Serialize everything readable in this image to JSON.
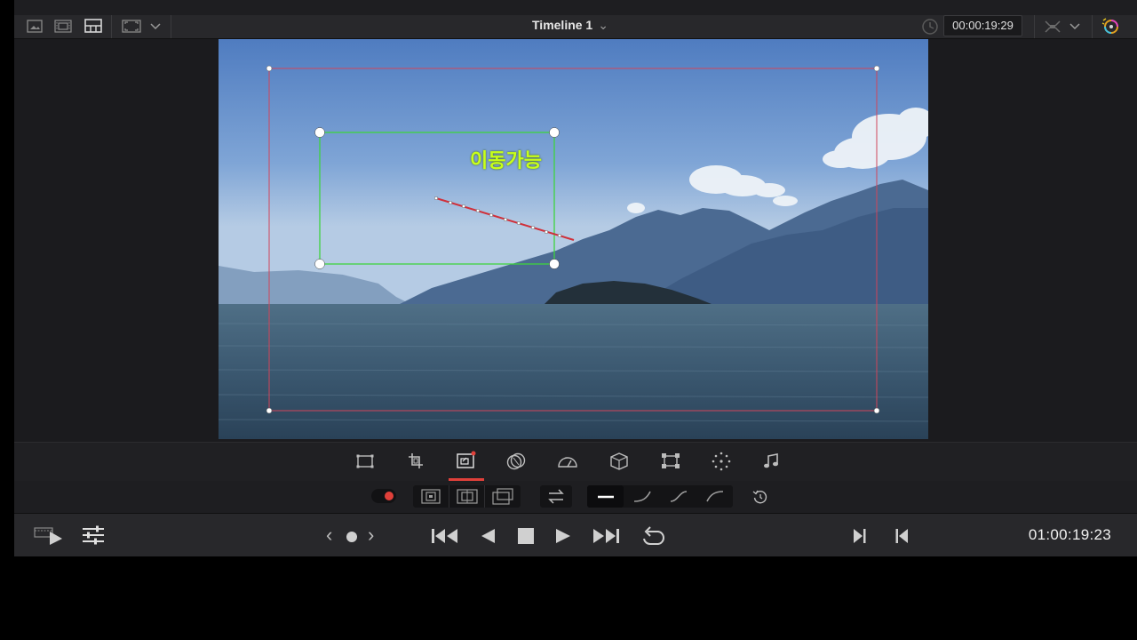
{
  "top_bar": {
    "timeline_title": "Timeline 1",
    "timeline_chevron": "⌄",
    "timecode": "00:00:19:29",
    "icons": [
      "image-icon",
      "filmstrip-icon",
      "grid-layout-icon",
      "viewer-size-icon",
      "chevron-down-icon",
      "clock-icon",
      "zoom-fit-icon",
      "color-wheel-icon"
    ]
  },
  "viewer": {
    "overlay_label": "이동가능"
  },
  "tools": {
    "items": [
      "transform-icon",
      "crop-icon",
      "dynamic-zoom-icon",
      "opentfx-icon",
      "speed-icon",
      "3d-box-icon",
      "stabilize-icon",
      "smart-reframe-icon",
      "audio-icon"
    ],
    "active": "dynamic-zoom-icon"
  },
  "dynamic_zoom_bar": {
    "record_toggle": "record-toggle",
    "modes": [
      "start-frame-icon",
      "zoom-window-icon",
      "end-frame-icon"
    ],
    "swap": "swap-icon",
    "easing": [
      "linear-ease-icon",
      "ease-in-icon",
      "ease-in-out-icon",
      "ease-out-icon"
    ],
    "active_easing": "linear-ease-icon",
    "reset": "reset-icon"
  },
  "transport": {
    "prev_label": "‹",
    "next_label": "›",
    "timecode": "01:00:19:23"
  },
  "colors": {
    "accent_red": "#e0403a",
    "overlay_green": "#c8ff1a",
    "zoom_box_green": "#3ed43e",
    "frame_red": "#d0455a"
  }
}
